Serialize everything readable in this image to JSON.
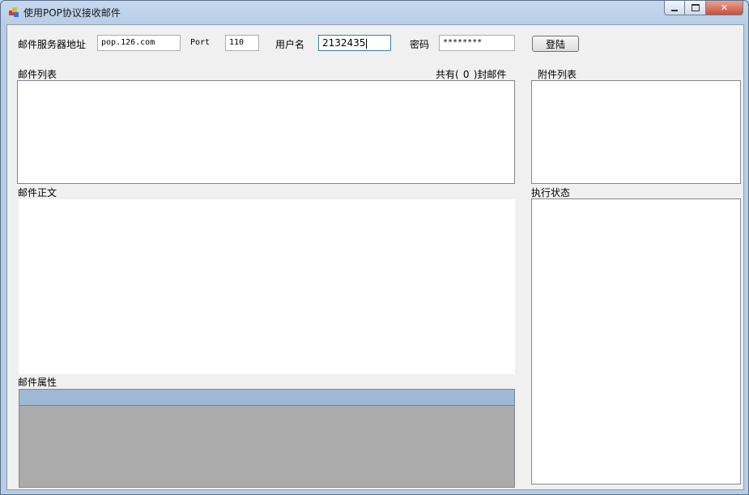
{
  "window": {
    "title": "使用POP协议接收邮件",
    "controls": {
      "minimize": "minimize-icon",
      "maximize": "maximize-icon",
      "close": "close-icon"
    }
  },
  "login": {
    "server_label": "邮件服务器地址",
    "server_value": "pop.126.com",
    "port_label": "Port",
    "port_value": "110",
    "username_label": "用户名",
    "username_value": "2132435",
    "password_label": "密码",
    "password_value": "********",
    "login_button": "登陆"
  },
  "mail_list": {
    "label": "邮件列表",
    "count_prefix": "共有(",
    "count_value": "0",
    "count_suffix": ")封邮件"
  },
  "attachments": {
    "label": "附件列表"
  },
  "mail_body": {
    "label": "邮件正文"
  },
  "status": {
    "label": "执行状态"
  },
  "properties": {
    "label": "邮件属性"
  },
  "colors": {
    "grid_header": "#9eb8d6",
    "grid_background": "#ababab",
    "focus_border": "#3c7fb1"
  }
}
